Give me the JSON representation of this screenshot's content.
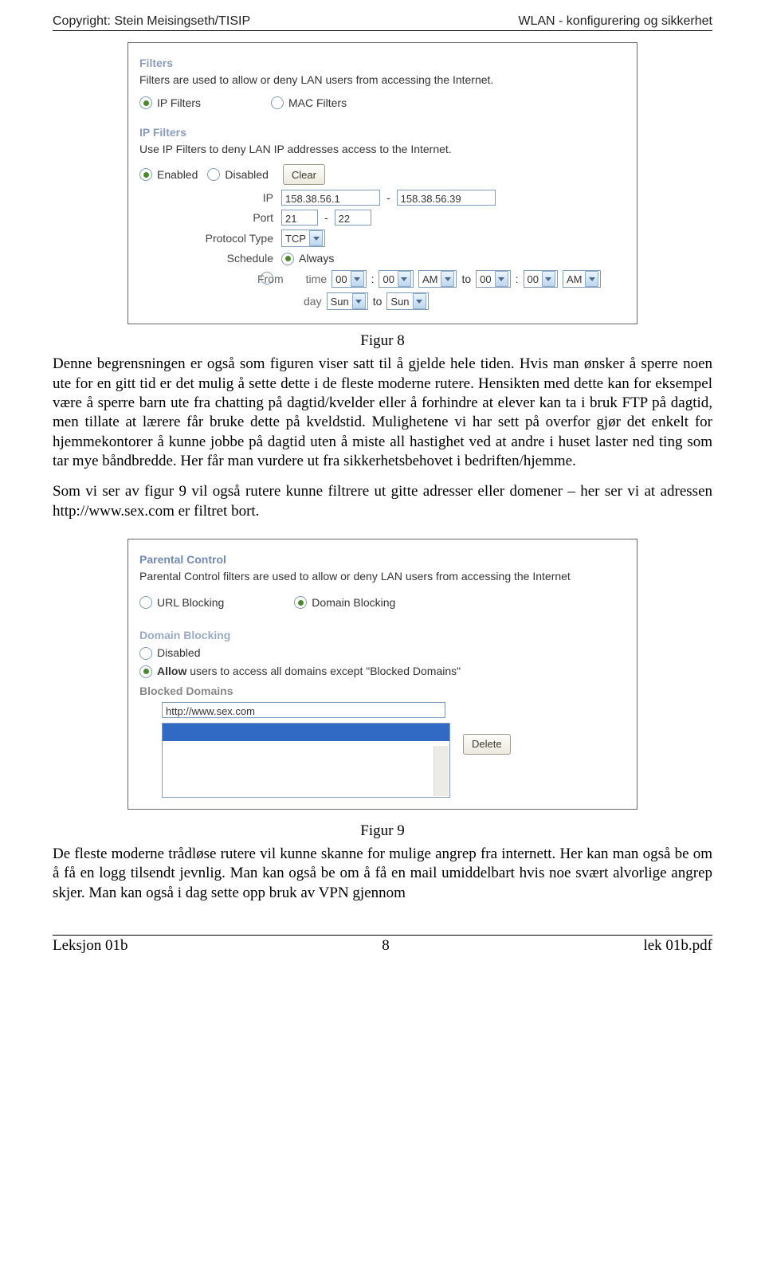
{
  "header": {
    "left": "Copyright: Stein Meisingseth/TISIP",
    "right": "WLAN - konfigurering og sikkerhet"
  },
  "panel1": {
    "filters": {
      "title": "Filters",
      "desc": "Filters are used to allow or deny LAN users from accessing the Internet.",
      "ipFilters": "IP Filters",
      "macFilters": "MAC Filters"
    },
    "ipFilters": {
      "title": "IP Filters",
      "desc": "Use IP Filters to deny LAN IP addresses access to the Internet.",
      "enabled": "Enabled",
      "disabled": "Disabled",
      "clear": "Clear",
      "ipLabel": "IP",
      "ipFrom": "158.38.56.1",
      "dash": "-",
      "ipTo": "158.38.56.39",
      "portLabel": "Port",
      "portFrom": "21",
      "portTo": "22",
      "protoLabel": "Protocol Type",
      "proto": "TCP",
      "schedLabel": "Schedule",
      "always": "Always",
      "from": "From",
      "timeLabel": "time",
      "h1": "00",
      "m1": "00",
      "ampm1": "AM",
      "to": "to",
      "h2": "00",
      "m2": "00",
      "ampm2": "AM",
      "dayLabel": "day",
      "day1": "Sun",
      "day2": "Sun"
    }
  },
  "caption1": "Figur 8",
  "para1": "Denne begrensningen er også som figuren viser satt til å gjelde hele tiden. Hvis man ønsker å sperre noen ute for en gitt tid er det mulig å sette dette i de fleste moderne rutere. Hensikten med dette kan for eksempel være å sperre barn ute fra chatting på dagtid/kvelder eller å forhindre at elever kan ta i bruk FTP på dagtid, men tillate at lærere får bruke dette på kveldstid. Mulighetene vi har sett på overfor gjør det enkelt for hjemmekontorer å kunne jobbe på dagtid uten å miste all hastighet ved at andre i huset laster ned ting som tar mye båndbredde. Her får man vurdere ut fra sikkerhetsbehovet i bedriften/hjemme.",
  "para2": "Som vi ser av figur 9 vil også rutere kunne filtrere ut gitte adresser eller domener – her ser vi at adressen http://www.sex.com er filtret bort.",
  "panel2": {
    "title": "Parental Control",
    "desc": "Parental Control filters are used to allow or deny LAN users from accessing the Internet",
    "urlBlocking": "URL Blocking",
    "domainBlocking": "Domain Blocking",
    "dbTitle": "Domain Blocking",
    "disabled": "Disabled",
    "allow": "Allow",
    "allowRest": " users to access all domains except \"Blocked Domains\"",
    "blockedTitle": "Blocked Domains",
    "entry": "http://www.sex.com",
    "delete": "Delete"
  },
  "caption2": "Figur 9",
  "para3": "De fleste moderne trådløse rutere vil kunne skanne for mulige angrep fra internett. Her kan man også be om å få en logg tilsendt jevnlig. Man kan også be om å få en mail umiddelbart hvis noe svært alvorlige angrep skjer. Man kan også i dag sette opp bruk av VPN gjennom",
  "footer": {
    "left": "Leksjon 01b",
    "center": "8",
    "right": "lek 01b.pdf"
  }
}
